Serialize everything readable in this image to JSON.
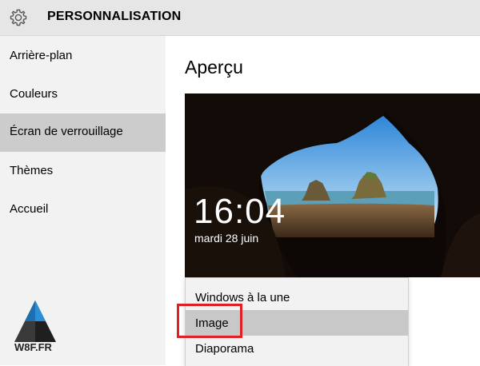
{
  "window": {
    "title": "PERSONNALISATION",
    "icon": "gear-icon"
  },
  "sidebar": {
    "items": [
      {
        "label": "Arrière-plan",
        "selected": false
      },
      {
        "label": "Couleurs",
        "selected": false
      },
      {
        "label": "Écran de verrouillage",
        "selected": true
      },
      {
        "label": "Thèmes",
        "selected": false
      },
      {
        "label": "Accueil",
        "selected": false
      }
    ],
    "logo_text": "W8F.FR"
  },
  "main": {
    "heading": "Aperçu",
    "preview": {
      "time": "16:04",
      "date": "mardi 28 juin"
    },
    "dropdown": {
      "options": [
        {
          "label": "Windows à la une",
          "highlighted": false
        },
        {
          "label": "Image",
          "highlighted": true
        },
        {
          "label": "Diaporama",
          "highlighted": false
        }
      ]
    }
  },
  "colors": {
    "titlebar_bg": "#e6e6e6",
    "sidebar_bg": "#f2f2f2",
    "selected_bg": "#cccccc",
    "annotation_red": "#e02020"
  }
}
